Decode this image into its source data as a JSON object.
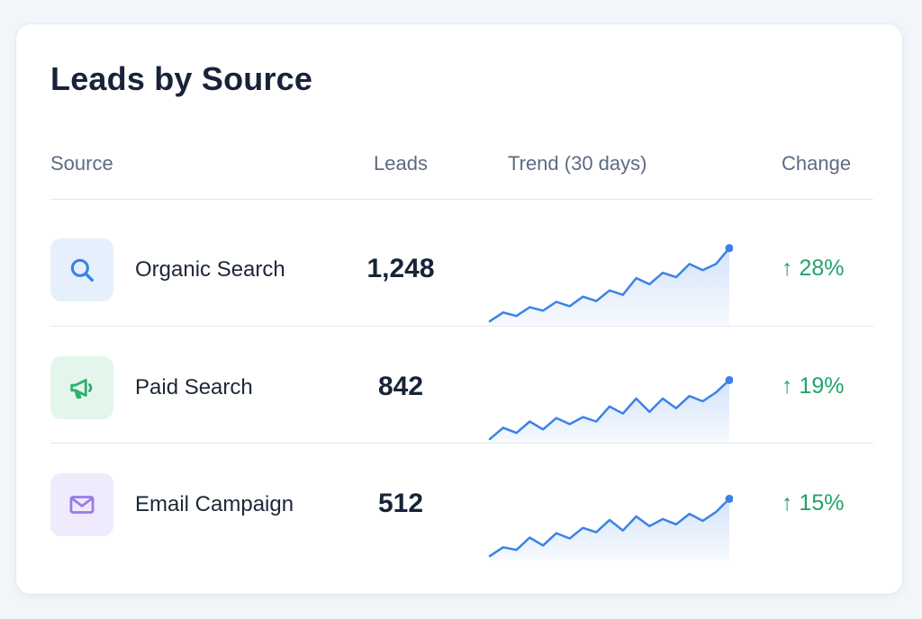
{
  "card": {
    "title": "Leads by Source"
  },
  "table": {
    "headers": {
      "source": "Source",
      "leads": "Leads",
      "trend": "Trend (30 days)",
      "change": "Change"
    },
    "rows": [
      {
        "source": "Organic Search",
        "icon": "search-icon",
        "leads": "1,248",
        "change_arrow": "↑",
        "change": "28%",
        "trend": [
          5,
          15,
          11,
          21,
          17,
          27,
          22,
          33,
          28,
          40,
          35,
          54,
          47,
          60,
          55,
          70,
          63,
          70,
          88
        ]
      },
      {
        "source": "Paid Search",
        "icon": "megaphone-icon",
        "leads": "842",
        "change_arrow": "↑",
        "change": "19%",
        "trend": [
          5,
          18,
          12,
          25,
          16,
          29,
          22,
          30,
          25,
          42,
          34,
          51,
          36,
          51,
          40,
          54,
          48,
          58,
          72
        ]
      },
      {
        "source": "Email Campaign",
        "icon": "mail-icon",
        "leads": "512",
        "change_arrow": "↑",
        "change": "15%",
        "trend": [
          5,
          15,
          12,
          26,
          17,
          31,
          25,
          37,
          32,
          46,
          34,
          50,
          39,
          47,
          41,
          53,
          45,
          55,
          70
        ]
      }
    ]
  },
  "colors": {
    "accent": "#3b82e8",
    "positive": "#22a36b",
    "organic_bg": "#e6f0fd",
    "organic_fg": "#3b82e8",
    "paid_bg": "#e4f6ec",
    "paid_fg": "#2fb06c",
    "email_bg": "#efeafc",
    "email_fg": "#9b7be6"
  }
}
